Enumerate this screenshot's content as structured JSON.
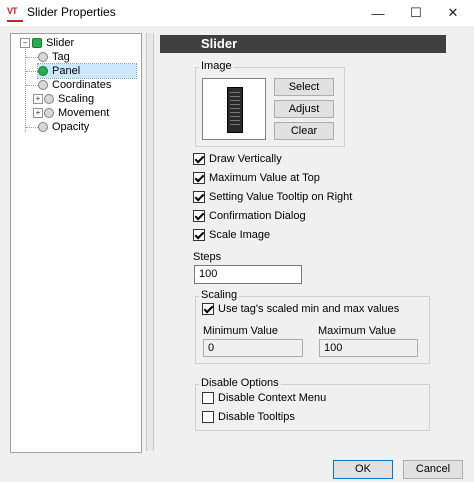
{
  "window": {
    "title": "Slider Properties",
    "app_icon_text": "VT",
    "minimize_glyph": "—",
    "maximize_glyph": "☐",
    "close_glyph": "✕"
  },
  "tree": {
    "root": "Slider",
    "items": [
      {
        "label": "Tag"
      },
      {
        "label": "Panel"
      },
      {
        "label": "Coordinates"
      },
      {
        "label": "Scaling"
      },
      {
        "label": "Movement"
      },
      {
        "label": "Opacity"
      }
    ],
    "selected": "Panel"
  },
  "panel": {
    "header": "Slider",
    "image": {
      "group_label": "Image",
      "select_label": "Select",
      "adjust_label": "Adjust",
      "clear_label": "Clear"
    },
    "options": [
      {
        "label": "Draw Vertically",
        "checked": true
      },
      {
        "label": "Maximum Value at Top",
        "checked": true
      },
      {
        "label": "Setting Value Tooltip on Right",
        "checked": true
      },
      {
        "label": "Confirmation Dialog",
        "checked": true
      },
      {
        "label": "Scale Image",
        "checked": true
      }
    ],
    "steps": {
      "label": "Steps",
      "value": "100"
    },
    "scaling": {
      "group_label": "Scaling",
      "use_scaled_label": "Use tag's scaled min and max values",
      "use_scaled_checked": true,
      "min_label": "Minimum Value",
      "min_value": "0",
      "max_label": "Maximum Value",
      "max_value": "100"
    },
    "disable_options": {
      "group_label": "Disable Options",
      "context_menu_label": "Disable Context Menu",
      "context_menu_checked": false,
      "tooltips_label": "Disable Tooltips",
      "tooltips_checked": false
    }
  },
  "footer": {
    "ok_label": "OK",
    "cancel_label": "Cancel"
  }
}
